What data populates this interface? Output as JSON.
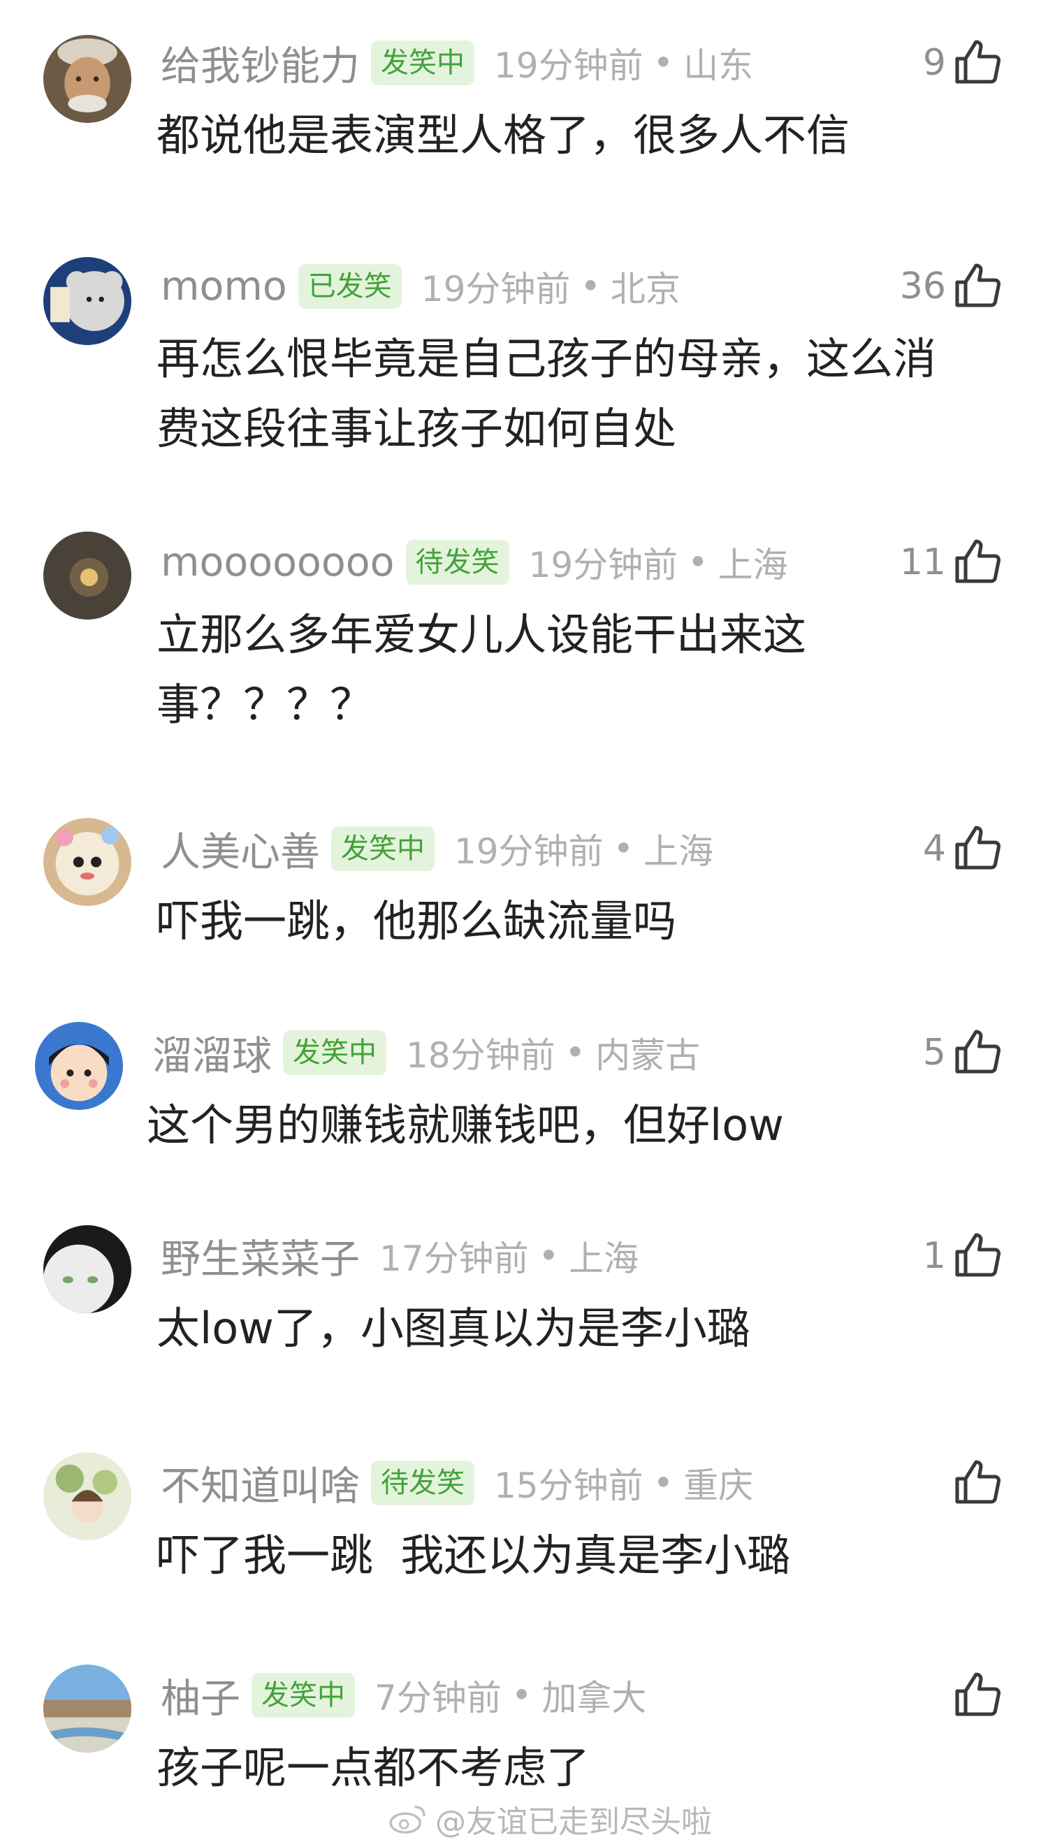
{
  "accent_color": "#43a23b",
  "badge_background": "#e4f4dc",
  "comments": [
    {
      "username": "给我钞能力",
      "badge": "发笑中",
      "time": "19分钟前",
      "location": "山东",
      "likes": "9",
      "content_lines": [
        "都说他是表演型人格了，很多人不信"
      ]
    },
    {
      "username": "momo",
      "badge": "已发笑",
      "time": "19分钟前",
      "location": "北京",
      "likes": "36",
      "content_lines": [
        "再怎么恨毕竟是自己孩子的母亲，这么消",
        "费这段往事让孩子如何自处"
      ]
    },
    {
      "username": "moooooooo",
      "badge": "待发笑",
      "time": "19分钟前",
      "location": "上海",
      "likes": "11",
      "content_lines": [
        "立那么多年爱女儿人设能干出来这",
        "事？？？？"
      ]
    },
    {
      "username": "人美心善",
      "badge": "发笑中",
      "time": "19分钟前",
      "location": "上海",
      "likes": "4",
      "content_lines": [
        "吓我一跳，他那么缺流量吗"
      ]
    },
    {
      "username": "溜溜球",
      "badge": "发笑中",
      "time": "18分钟前",
      "location": "内蒙古",
      "likes": "5",
      "content_lines": [
        "这个男的赚钱就赚钱吧，但好low"
      ]
    },
    {
      "username": "野生菜菜子",
      "badge": "",
      "time": "17分钟前",
      "location": "上海",
      "likes": "1",
      "content_lines": [
        "太low了，小图真以为是李小璐"
      ]
    },
    {
      "username": "不知道叫啥",
      "badge": "待发笑",
      "time": "15分钟前",
      "location": "重庆",
      "likes": "",
      "content_lines": [
        "吓了我一跳  我还以为真是李小璐"
      ]
    },
    {
      "username": "柚子",
      "badge": "发笑中",
      "time": "7分钟前",
      "location": "加拿大",
      "likes": "",
      "content_lines": [
        "孩子呢一点都不考虑了"
      ]
    }
  ],
  "separator_dot": "•",
  "avatars": [
    "avatar-man-cap",
    "avatar-cartoon-mouse",
    "avatar-dark-moon",
    "avatar-plush-toy",
    "avatar-cartoon-girl",
    "avatar-white-cat",
    "avatar-girl-leaves",
    "avatar-landscape"
  ],
  "like_icon": "thumbs-up-icon",
  "watermark": {
    "icon": "weibo-icon",
    "text": "@友谊已走到尽头啦"
  }
}
